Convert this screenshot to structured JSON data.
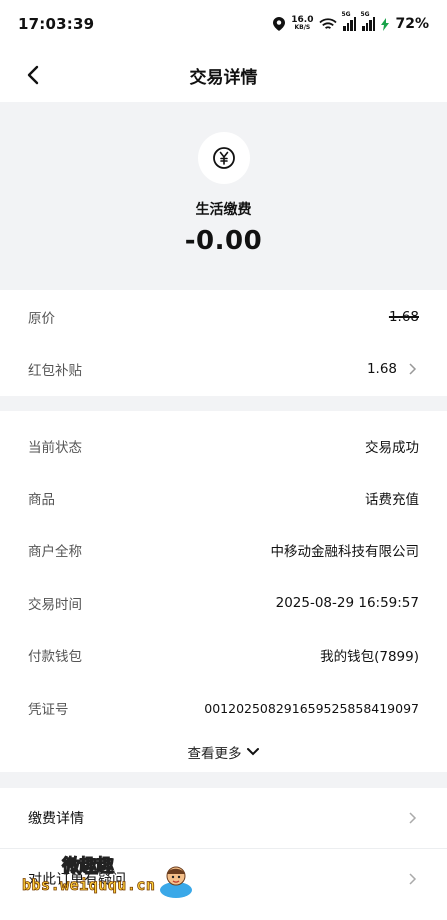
{
  "status_bar": {
    "time": "17:03:39",
    "net_speed": "16.0",
    "net_unit": "KB/S",
    "sig1": "5G",
    "sig2": "5G",
    "battery": "72%"
  },
  "header": {
    "title": "交易详情"
  },
  "hero": {
    "icon": "yuan-icon",
    "name": "生活缴费",
    "amount": "-0.00"
  },
  "price_section": {
    "original_price_label": "原价",
    "original_price_value": "1.68",
    "subsidy_label": "红包补贴",
    "subsidy_value": "1.68"
  },
  "details": {
    "status_label": "当前状态",
    "status_value": "交易成功",
    "product_label": "商品",
    "product_value": "话费充值",
    "merchant_label": "商户全称",
    "merchant_value": "中移动金融科技有限公司",
    "time_label": "交易时间",
    "time_value": "2025-08-29 16:59:57",
    "wallet_label": "付款钱包",
    "wallet_value": "我的钱包(7899)",
    "voucher_label": "凭证号",
    "voucher_value": "0012025082916595258584190​97",
    "more_label": "查看更多"
  },
  "links": {
    "payment_detail": "缴费详情",
    "question": "对此订单有疑问"
  },
  "watermark": {
    "cn": "微趣趣",
    "url": "bbs.weiququ.cn"
  },
  "colors": {
    "success": "#1a9a4b",
    "band": "#f2f3f5"
  }
}
